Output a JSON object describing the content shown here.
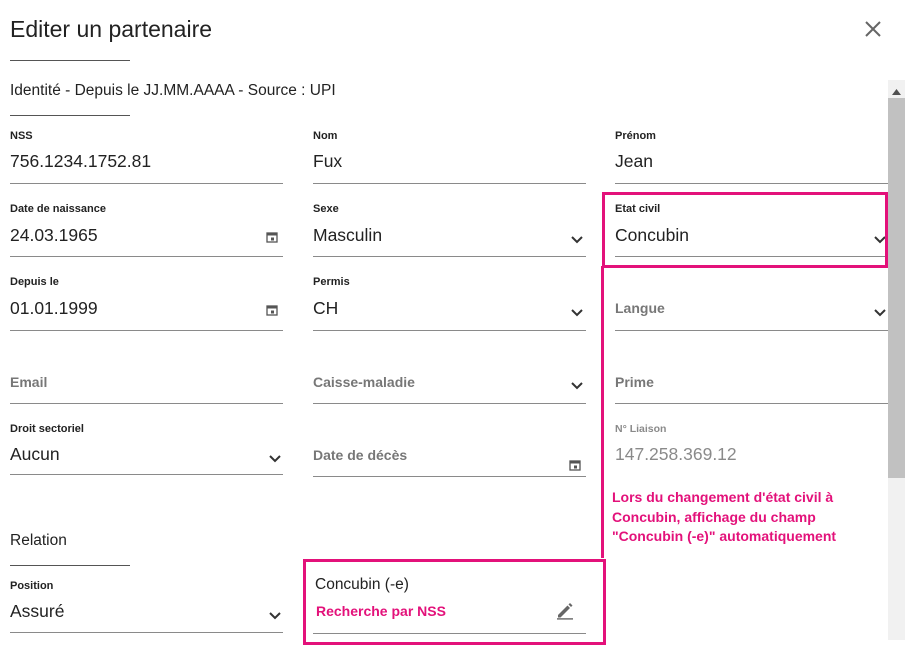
{
  "dialog": {
    "title": "Editer un partenaire",
    "close_icon": "close-icon"
  },
  "identity": {
    "heading": "Identité - Depuis le JJ.MM.AAAA - Source : UPI",
    "nss_label": "NSS",
    "nss_value": "756.1234.1752.81",
    "nom_label": "Nom",
    "nom_value": "Fux",
    "prenom_label": "Prénom",
    "prenom_value": "Jean",
    "naissance_label": "Date de naissance",
    "naissance_value": "24.03.1965",
    "sexe_label": "Sexe",
    "sexe_value": "Masculin",
    "etat_label": "Etat civil",
    "etat_value": "Concubin",
    "depuis_label": "Depuis le",
    "depuis_value": "01.01.1999",
    "permis_label": "Permis",
    "permis_value": "CH",
    "langue_placeholder": "Langue",
    "email_placeholder": "Email",
    "caisse_placeholder": "Caisse-maladie",
    "prime_placeholder": "Prime",
    "droit_label": "Droit sectoriel",
    "droit_value": "Aucun",
    "deces_placeholder": "Date de décès",
    "liaison_label": "N° Liaison",
    "liaison_value": "147.258.369.12"
  },
  "annotation": {
    "note_line1": "Lors du changement d'état civil à",
    "note_line2": "Concubin, affichage du champ",
    "note_line3": "\"Concubin (-e)\" automatiquement",
    "color": "#e3117a"
  },
  "relation": {
    "heading": "Relation",
    "position_label": "Position",
    "position_value": "Assuré",
    "concubin_label": "Concubin (-e)",
    "concubin_action": "Recherche par NSS",
    "edit_icon": "pencil-edit-icon"
  }
}
